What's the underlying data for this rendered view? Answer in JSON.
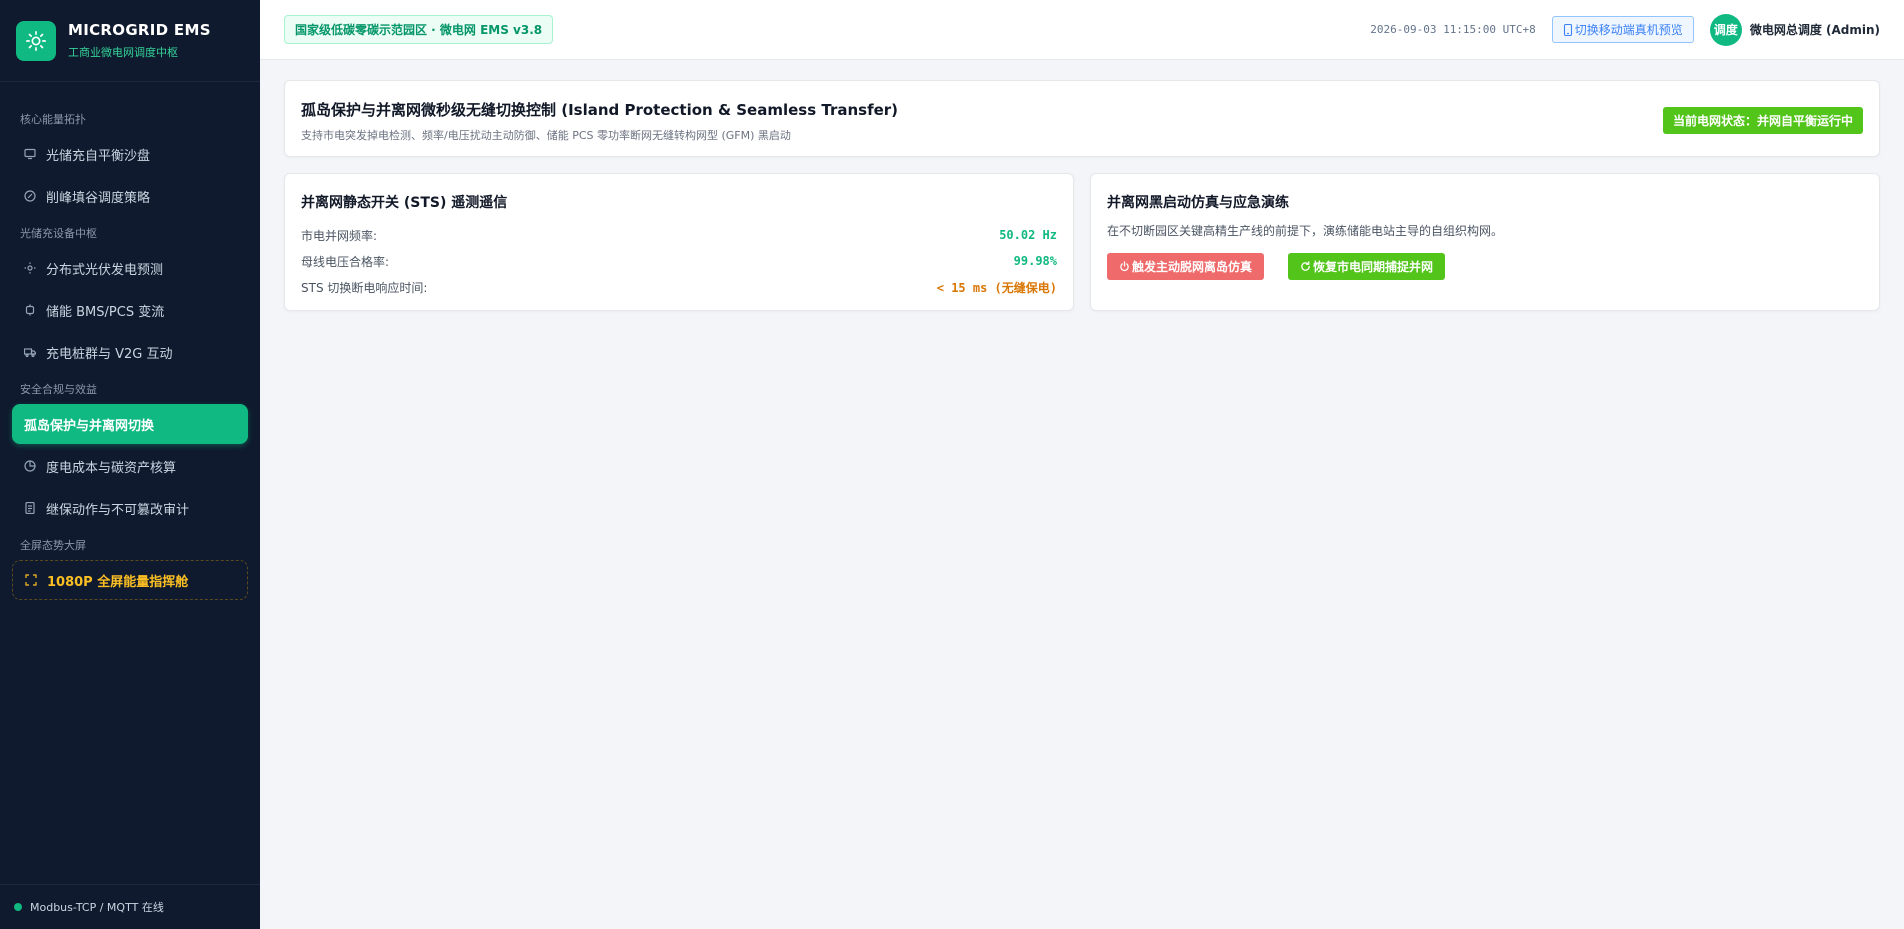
{
  "brand": {
    "title": "MICROGRID EMS",
    "subtitle": "工商业微电网调度中枢"
  },
  "nav": {
    "groups": [
      {
        "label": "核心能量拓扑",
        "items": [
          {
            "label": "光储充自平衡沙盘",
            "icon": "monitor-icon"
          },
          {
            "label": "削峰填谷调度策略",
            "icon": "compass-icon"
          }
        ]
      },
      {
        "label": "光储充设备中枢",
        "items": [
          {
            "label": "分布式光伏发电预测",
            "icon": "sun-icon"
          },
          {
            "label": "储能 BMS/PCS 变流",
            "icon": "chip-icon"
          },
          {
            "label": "充电桩群与 V2G 互动",
            "icon": "truck-icon"
          }
        ]
      },
      {
        "label": "安全合规与效益",
        "items": [
          {
            "label": "孤岛保护与并离网切换",
            "icon": "shield-icon",
            "active": true
          },
          {
            "label": "度电成本与碳资产核算",
            "icon": "pie-chart-icon"
          },
          {
            "label": "继保动作与不可篡改审计",
            "icon": "document-icon"
          }
        ]
      },
      {
        "label": "全屏态势大屏",
        "items": [
          {
            "label": "1080P 全屏能量指挥舱",
            "icon": "fullscreen-icon"
          }
        ]
      }
    ]
  },
  "footer": {
    "status": "Modbus-TCP / MQTT 在线"
  },
  "topbar": {
    "zone": "国家级低碳零碳示范园区 · 微电网 EMS v3.8",
    "datetime": "2026-09-03 11:15:00 UTC+8",
    "mobile_button": "切换移动端真机预览",
    "avatar": "调度",
    "user": "微电网总调度 (Admin)"
  },
  "header": {
    "title": "孤岛保护与并离网微秒级无缝切换控制 (Island Protection & Seamless Transfer)",
    "subtitle": "支持市电突发掉电检测、频率/电压扰动主动防御、储能 PCS 零功率断网无缝转构网型 (GFM) 黑启动",
    "status": "当前电网状态：并网自平衡运行中"
  },
  "sts_panel": {
    "title": "并离网静态开关 (STS) 遥测遥信",
    "metrics": [
      {
        "label": "市电并网频率:",
        "value": "50.02 Hz"
      },
      {
        "label": "母线电压合格率:",
        "value": "99.98%"
      },
      {
        "label": "STS 切换断电响应时间:",
        "value": "< 15 ms (无缝保电)"
      }
    ]
  },
  "drill_panel": {
    "title": "并离网黑启动仿真与应急演练",
    "description": "在不切断园区关键高精生产线的前提下，演练储能电站主导的自组织构网。",
    "btn_island": "触发主动脱网离岛仿真",
    "btn_resync": "恢复市电同期捕捉并网"
  },
  "colors": {
    "accent": "#10b981",
    "sidebar_bg": "#0f1a2e",
    "danger": "#ef6b6b",
    "ok": "#52c41a",
    "warn": "#d97706"
  }
}
